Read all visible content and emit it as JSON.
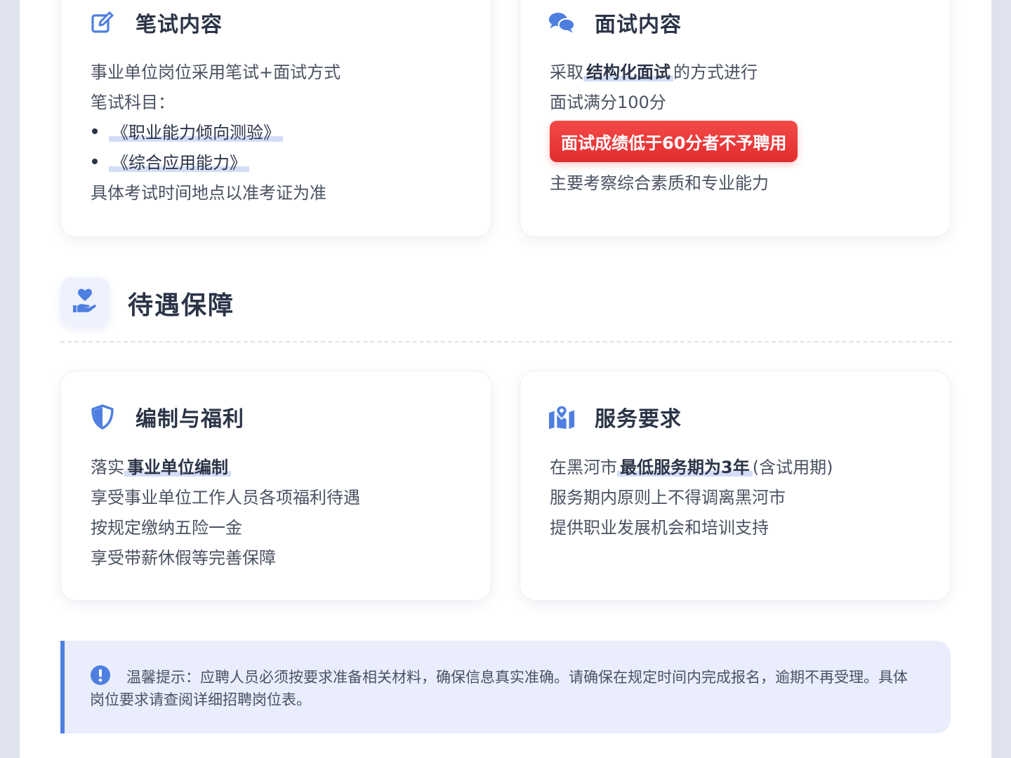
{
  "written_card": {
    "title": "笔试内容",
    "icon": "edit-icon",
    "lines": [
      "事业单位岗位采用笔试+面试方式",
      "笔试科目："
    ],
    "subjects": [
      "《职业能力倾向测验》",
      "《综合应用能力》"
    ],
    "footer": "具体考试时间地点以准考证为准"
  },
  "interview_card": {
    "title": "面试内容",
    "icon": "chat-bubbles-icon",
    "method_prefix": "采取",
    "method_highlight": "结构化面试",
    "method_suffix": "的方式进行",
    "full_score": "面试满分100分",
    "warning": "面试成绩低于60分者不予聘用",
    "focus": "主要考察综合素质和专业能力"
  },
  "section": {
    "title": "待遇保障",
    "icon": "hand-heart-icon"
  },
  "benefits_card": {
    "title": "编制与福利",
    "icon": "shield-icon",
    "line1_prefix": "落实",
    "line1_highlight": "事业单位编制",
    "lines": [
      "享受事业单位工作人员各项福利待遇",
      "按规定缴纳五险一金",
      "享受带薪休假等完善保障"
    ]
  },
  "service_card": {
    "title": "服务要求",
    "icon": "map-pin-icon",
    "line1_prefix": "在黑河市",
    "line1_highlight": "最低服务期为3年",
    "line1_suffix": "(含试用期)",
    "lines": [
      "服务期内原则上不得调离黑河市",
      "提供职业发展机会和培训支持"
    ]
  },
  "tip": {
    "icon": "exclamation-circle-icon",
    "text": "温馨提示：应聘人员必须按要求准备相关材料，确保信息真实准确。请确保在规定时间内完成报名，逾期不再受理。具体岗位要求请查阅详细招聘岗位表。"
  },
  "colors": {
    "accent": "#4e7fe0",
    "highlight": "#d3ddf7",
    "warning": "#e8383a",
    "tip_background": "#e9edfc"
  }
}
